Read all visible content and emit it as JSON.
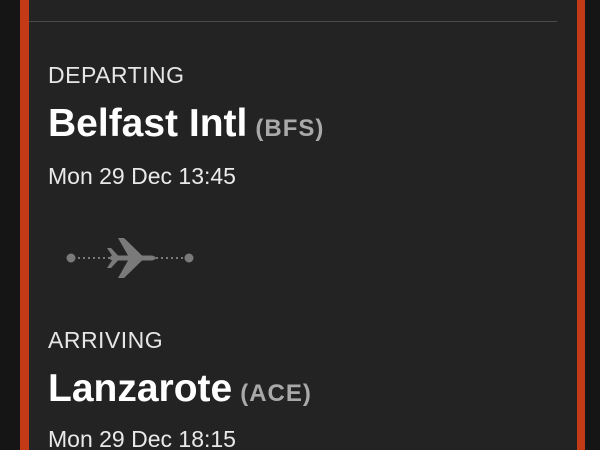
{
  "colors": {
    "accent": "#c23a16",
    "card_background": "#232323",
    "primary_text": "#ffffff",
    "secondary_text": "#a9a9a9"
  },
  "departing": {
    "label": "DEPARTING",
    "airport_name": "Belfast Intl",
    "airport_code": "(BFS)",
    "datetime": "Mon 29 Dec 13:45"
  },
  "route": {
    "icon": "plane-route-icon"
  },
  "arriving": {
    "label": "ARRIVING",
    "airport_name": "Lanzarote",
    "airport_code": "(ACE)",
    "datetime": "Mon 29 Dec 18:15"
  }
}
